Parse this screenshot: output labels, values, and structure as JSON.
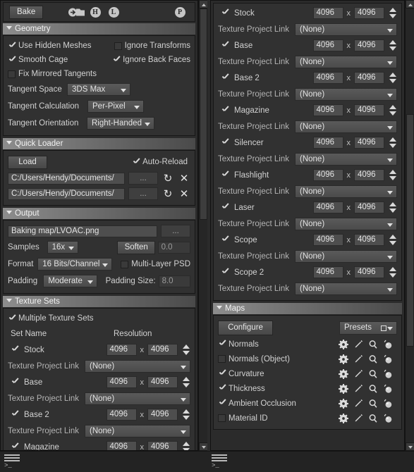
{
  "toolbar": {
    "bake_label": "Bake",
    "icons": [
      {
        "name": "import-folder-icon",
        "glyph": ""
      },
      {
        "name": "high-poly-icon",
        "glyph": "H"
      },
      {
        "name": "low-poly-icon",
        "glyph": "L"
      },
      {
        "name": "preferences-icon",
        "glyph": "P"
      }
    ]
  },
  "geometry": {
    "title": "Geometry",
    "use_hidden_meshes": "Use Hidden Meshes",
    "ignore_transforms": "Ignore Transforms",
    "smooth_cage": "Smooth Cage",
    "ignore_back_faces": "Ignore Back Faces",
    "fix_mirrored_tangents": "Fix Mirrored Tangents",
    "tangent_space_label": "Tangent Space",
    "tangent_space_value": "3DS Max",
    "tangent_calculation_label": "Tangent Calculation",
    "tangent_calculation_value": "Per-Pixel",
    "tangent_orientation_label": "Tangent Orientation",
    "tangent_orientation_value": "Right-Handed"
  },
  "quick_loader": {
    "title": "Quick Loader",
    "load_label": "Load",
    "auto_reload_label": "Auto-Reload",
    "paths": [
      "C:/Users/Hendy/Documents/",
      "C:/Users/Hendy/Documents/"
    ],
    "browse_label": "...",
    "reload_icon": "↻",
    "clear_icon": "✕"
  },
  "output": {
    "title": "Output",
    "path_value": "Baking map/LVOAC.png",
    "browse_label": "...",
    "samples_label": "Samples",
    "samples_value": "16x",
    "soften_label": "Soften",
    "soften_value": "0.0",
    "format_label": "Format",
    "format_value": "16 Bits/Channel",
    "multi_layer_psd_label": "Multi-Layer PSD",
    "padding_label": "Padding",
    "padding_value": "Moderate",
    "padding_size_label": "Padding Size:",
    "padding_size_value": "8.0"
  },
  "texture_sets": {
    "title": "Texture Sets",
    "multiple_texture_sets_label": "Multiple Texture Sets",
    "col_set_name": "Set Name",
    "col_resolution": "Resolution",
    "texture_project_link_label": "Texture Project Link",
    "texture_project_link_value": "(None)",
    "x_separator": "x",
    "sets": [
      {
        "name": "Stock",
        "checked": true,
        "width": "4096",
        "height": "4096",
        "link": "(None)"
      },
      {
        "name": "Base",
        "checked": true,
        "width": "4096",
        "height": "4096",
        "link": "(None)"
      },
      {
        "name": "Base 2",
        "checked": true,
        "width": "4096",
        "height": "4096",
        "link": "(None)"
      },
      {
        "name": "Magazine",
        "checked": true,
        "width": "4096",
        "height": "4096",
        "link": "(None)"
      },
      {
        "name": "Silencer",
        "checked": true,
        "width": "4096",
        "height": "4096",
        "link": "(None)"
      },
      {
        "name": "Flashlight",
        "checked": true,
        "width": "4096",
        "height": "4096",
        "link": "(None)"
      },
      {
        "name": "Laser",
        "checked": true,
        "width": "4096",
        "height": "4096",
        "link": "(None)"
      },
      {
        "name": "Scope",
        "checked": true,
        "width": "4096",
        "height": "4096",
        "link": "(None)"
      },
      {
        "name": "Scope 2",
        "checked": true,
        "width": "4096",
        "height": "4096",
        "link": "(None)"
      }
    ]
  },
  "maps": {
    "title": "Maps",
    "configure_label": "Configure",
    "presets_label": "Presets",
    "items": [
      {
        "name": "Normals",
        "checked": true
      },
      {
        "name": "Normals (Object)",
        "checked": false
      },
      {
        "name": "Curvature",
        "checked": true
      },
      {
        "name": "Thickness",
        "checked": true
      },
      {
        "name": "Ambient Occlusion",
        "checked": true
      },
      {
        "name": "Material ID",
        "checked": false
      }
    ],
    "row_icons": [
      "gear-icon",
      "pencil-icon",
      "magnifier-icon",
      "sphere-preview-icon"
    ]
  },
  "console": {
    "left_prompt": ">_",
    "right_prompt": ">_"
  },
  "colors": {
    "panel_bg": "#2b2b2b",
    "group_bg": "#313131",
    "header_light": "#8d8d8d",
    "text": "#d2d2d2",
    "field_bg": "#4e4e4e"
  }
}
